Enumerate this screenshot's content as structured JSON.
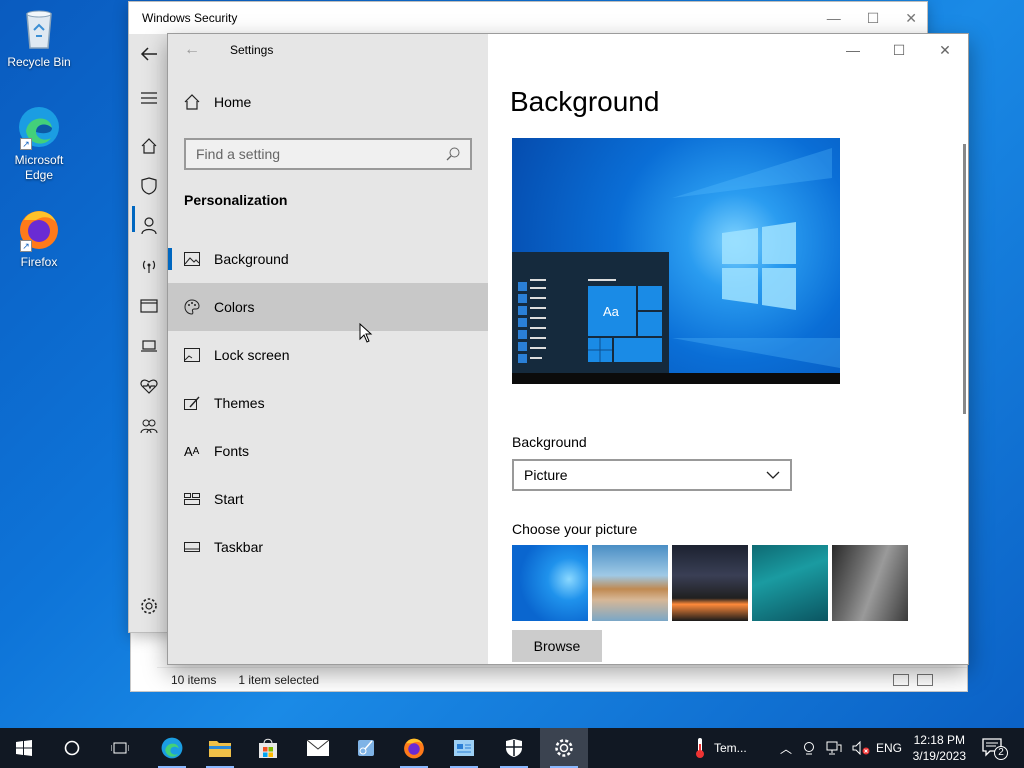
{
  "desktop": {
    "icons": [
      {
        "label": "Recycle Bin"
      },
      {
        "label": "Microsoft Edge"
      },
      {
        "label": "Firefox"
      }
    ]
  },
  "explorer": {
    "status_items": "10 items",
    "status_selected": "1 item selected"
  },
  "windows_security": {
    "title": "Windows Security"
  },
  "settings": {
    "title": "Settings",
    "home_label": "Home",
    "search": {
      "placeholder": "Find a setting"
    },
    "section": "Personalization",
    "menu": [
      {
        "label": "Background",
        "icon": "picture-icon"
      },
      {
        "label": "Colors",
        "icon": "palette-icon"
      },
      {
        "label": "Lock screen",
        "icon": "lock-screen-icon"
      },
      {
        "label": "Themes",
        "icon": "themes-icon"
      },
      {
        "label": "Fonts",
        "icon": "fonts-icon"
      },
      {
        "label": "Start",
        "icon": "start-icon"
      },
      {
        "label": "Taskbar",
        "icon": "taskbar-icon"
      }
    ],
    "selected_item": "Background",
    "hovered_item": "Colors",
    "page_title": "Background",
    "preview_sample": "Aa",
    "background_label": "Background",
    "background_value": "Picture",
    "choose_label": "Choose your picture",
    "browse_label": "Browse"
  },
  "taskbar": {
    "weather_text": "Tem...",
    "language": "ENG",
    "time": "12:18 PM",
    "date": "3/19/2023",
    "notification_count": "2"
  },
  "colors": {
    "accent": "#0067c0",
    "taskbar": "#111823",
    "nav_bg": "#e6e6e6"
  }
}
